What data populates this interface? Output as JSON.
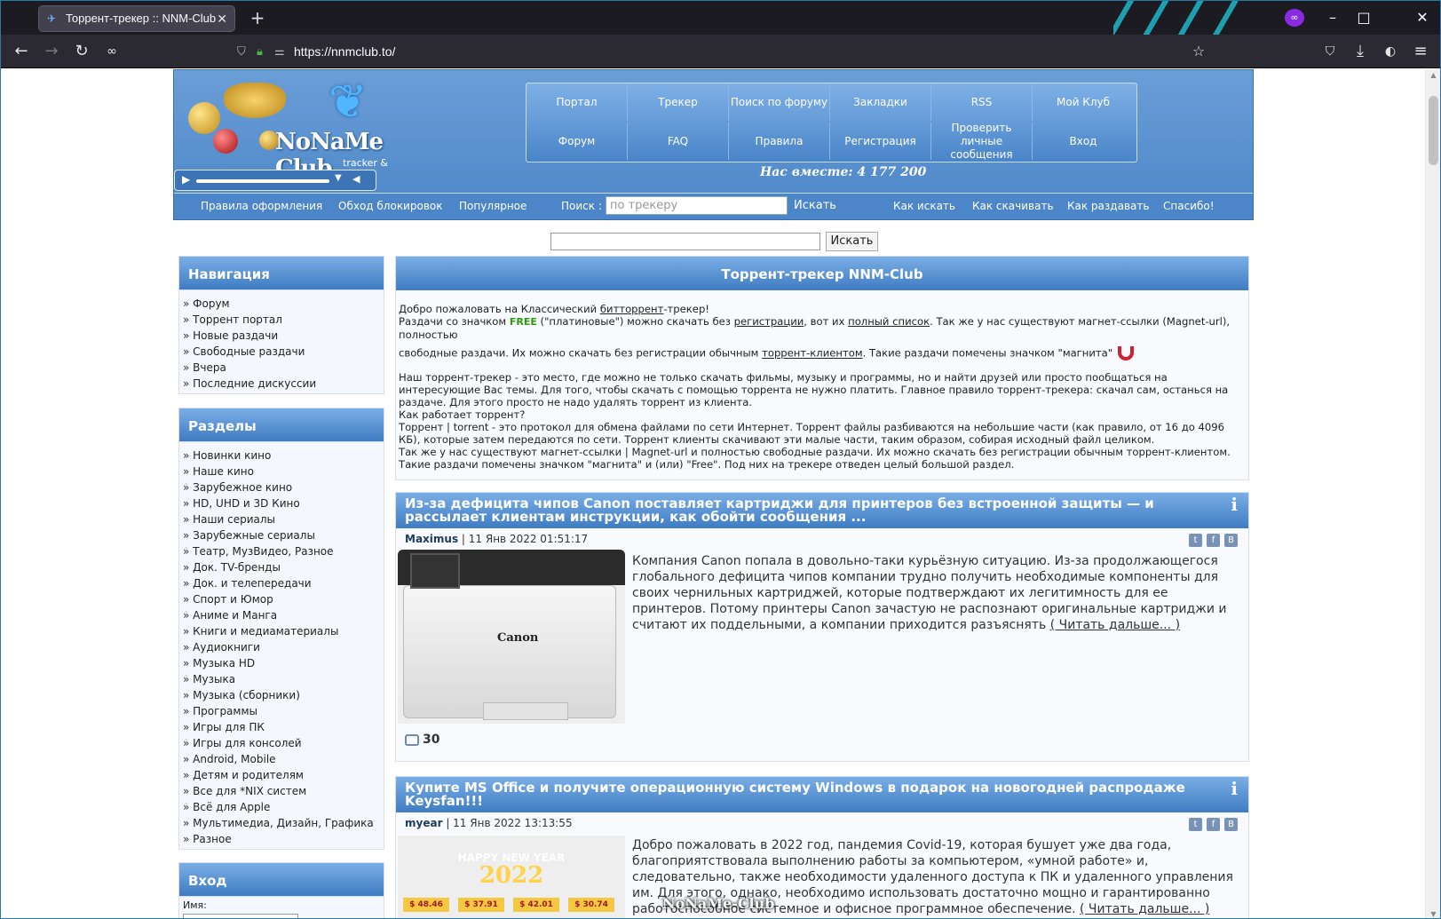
{
  "browser": {
    "tab_title": "Торрент-трекер :: NNM-Club",
    "url": "https://nnmclub.to/",
    "new_tab": "+",
    "close_tab": "✕"
  },
  "header": {
    "logo_name": "NoNaMe Club",
    "logo_sub": "tracker & forum",
    "menu": [
      {
        "label": "Портал"
      },
      {
        "label": "Трекер"
      },
      {
        "label": "Поиск по форуму"
      },
      {
        "label": "Закладки"
      },
      {
        "label": "RSS"
      },
      {
        "label": "Мой Клуб"
      },
      {
        "label": "Форум"
      },
      {
        "label": "FAQ"
      },
      {
        "label": "Правила"
      },
      {
        "label": "Регистрация"
      },
      {
        "label": "Проверить личные сообщения"
      },
      {
        "label": "Вход"
      }
    ],
    "together": "Нас вместе: 4 177 200"
  },
  "subnav": {
    "left": [
      "Правила оформления",
      "Обход блокировок",
      "Популярное"
    ],
    "search_label": "Поиск :",
    "search_placeholder": "по трекеру",
    "search_button": "Искать",
    "right": [
      "Как искать",
      "Как скачивать",
      "Как раздавать",
      "Спасибо!"
    ]
  },
  "site_search": {
    "button": "Искать",
    "value": ""
  },
  "sidebar": {
    "navigation": {
      "title": "Навигация",
      "items": [
        "Форум",
        "Торрент портал",
        "Новые раздачи",
        "Свободные раздачи",
        "Вчера",
        "Последние дискуссии"
      ]
    },
    "sections": {
      "title": "Разделы",
      "items": [
        "Новинки кино",
        "Наше кино",
        "Зарубежное кино",
        "HD, UHD и 3D Кино",
        "Наши сериалы",
        "Зарубежные сериалы",
        "Театр, МузВидео, Разное",
        "Док. TV-бренды",
        "Док. и телепередачи",
        "Спорт и Юмор",
        "Аниме и Манга",
        "Книги и медиаматериалы",
        "Аудиокниги",
        "Музыка HD",
        "Музыка",
        "Музыка (сборники)",
        "Программы",
        "Игры для ПК",
        "Игры для консолей",
        "Android, Mobile",
        "Детям и родителям",
        "Все для *NIX систем",
        "Всё для Apple",
        "Мультимедиа, Дизайн, Графика",
        "Разное"
      ]
    },
    "login": {
      "title": "Вход",
      "name_label": "Имя:"
    }
  },
  "welcome": {
    "title": "Торрент-трекер NNM-Club",
    "l1a": "Добро пожаловать на Классический ",
    "l1b": "битторрент",
    "l1c": "-трекер!",
    "l2a": "Раздачи со значком ",
    "free": "FREE",
    "l2b": " (\"платиновые\") можно скачать без ",
    "l2c": "регистрации",
    "l2d": ", вот их ",
    "l2e": "полный список",
    "l2f": ". Так же у нас существуют магнет-ссылки (Magnet-url), полностью",
    "l3a": "свободные раздачи. Их можно скачать без регистрации обычным ",
    "l3b": "торрент-клиентом",
    "l3c": ". Такие раздачи помечены значком \"магнита\"",
    "p2": "Наш торрент-трекер - это место, где можно не только скачать фильмы, музыку и программы, но и найти друзей или просто пообщаться на интересующие Вас темы. Для того, чтобы скачать с помощью торрента не нужно платить. Главное правило торрент-трекера: скачал сам, останься на раздаче. Для этого просто не надо удалять торрент из клиента.",
    "p3": "Как работает торрент?",
    "p4": "Торрент | torrent - это протокол для обмена файлами по сети Интернет. Торрент файлы разбиваются на небольшие части (как правило, от 16 до 4096 КБ), которые затем передаются по сети. Торрент клиенты скачивают эти малые части, таким образом, собирая исходный файл целиком.",
    "p5": "Так же у нас существуют магнет-ссылки | Magnet-url и полностью свободные раздачи. Их можно скачать без регистрации обычным торрент-клиентом. Такие раздачи помечены значком \"магнита\" и (или) \"Free\". Под них на трекере отведен целый большой раздел."
  },
  "news": [
    {
      "title": "Из-за дефицита чипов Canon поставляет картриджи для принтеров без встроенной защиты — и рассылает клиентам инструкции, как обойти сообщения ...",
      "author": "Maximus",
      "date": "| 11 Янв 2022 01:51:17",
      "text": "Компания Canon попала в довольно-таки курьёзную ситуацию. Из-за продолжающегося глобального дефицита чипов компании трудно получить необходимые компоненты для своих чернильных картриджей, которые подтверждают их легитимность для ее принтеров. Потому принтеры Canon зачастую не распознают оригинальные картриджи и считают их поддельными, а компании приходится разъяснять",
      "more": "( Читать дальше... )",
      "comments": "30",
      "image_brand": "Canon"
    },
    {
      "title": "Купите MS Office и получите операционную систему Windows в подарок на новогодней распродаже Keysfan!!!",
      "author": "myear",
      "date": "| 11 Янв 2022 13:13:55",
      "text": "Добро пожаловать в 2022 год, пандемия Covid-19, которая бушует уже два года, благоприятствовала выполнению работы за компьютером, «умной работе» и, следовательно, также необходимости удаленного доступа к ПК и удаленного управления им. Для этого, однако, необходимо использовать достаточно мощно и гарантированно работоспособное системное и офисное программное обеспечение.",
      "more": "( Читать дальше... )",
      "image_title": "HAPPY NEW YEAR",
      "image_year": "2022",
      "image_prices": [
        "$ 48.46",
        "$ 37.91",
        "$ 42.01",
        "$ 30.74"
      ]
    }
  ],
  "watermark": "NoNaMe-Club"
}
